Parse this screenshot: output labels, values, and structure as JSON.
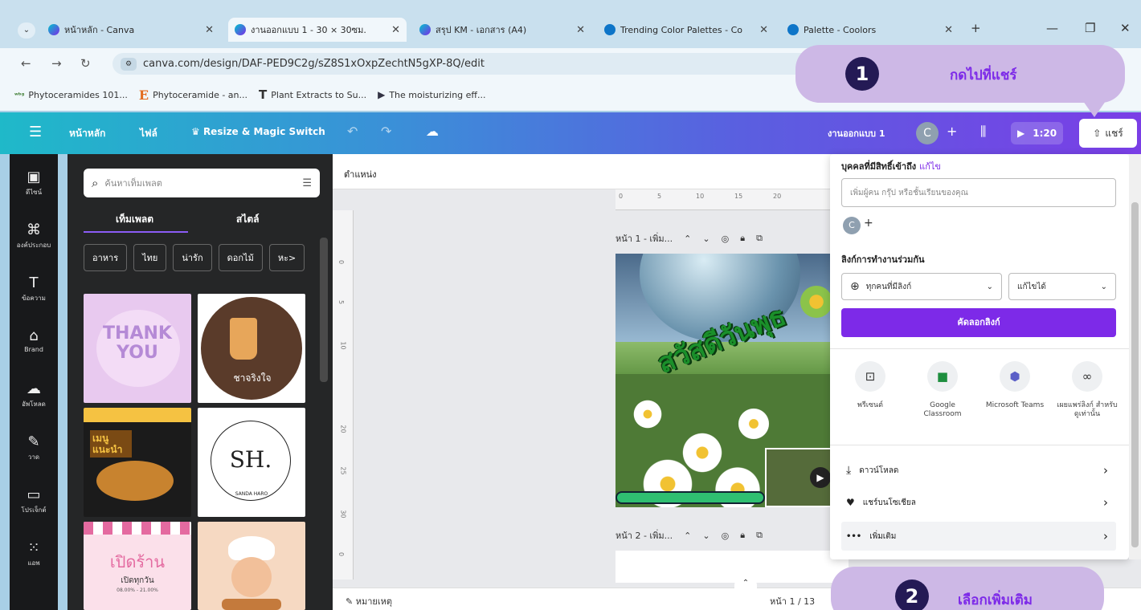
{
  "browser": {
    "tabs": [
      {
        "title": "หน้าหลัก - Canva",
        "favicon": "canva"
      },
      {
        "title": "งานออกแบบ 1 - 30 × 30ซม.",
        "favicon": "canva"
      },
      {
        "title": "สรุป KM - เอกสาร (A4)",
        "favicon": "canva"
      },
      {
        "title": "Trending Color Palettes - Co",
        "favicon": "coolors"
      },
      {
        "title": "Palette - Coolors",
        "favicon": "coolors"
      }
    ],
    "new_tab": "+",
    "url": "canva.com/design/DAF-PED9C2g/sZ8S1xOxpZechtN5gXP-8Q/edit",
    "bookmarks": [
      {
        "icon": "ʷᵇᵍ",
        "label": "Phytoceramides 101..."
      },
      {
        "icon": "E",
        "label": "Phytoceramide - an..."
      },
      {
        "icon": "T",
        "label": "Plant Extracts to Su..."
      },
      {
        "icon": "▶",
        "label": "The moisturizing eff..."
      }
    ]
  },
  "canva_bar": {
    "home": "หน้าหลัก",
    "file": "ไฟล์",
    "resize": "Resize & Magic Switch",
    "design_name": "งานออกแบบ 1",
    "avatar": "C",
    "present_time": "1:20",
    "share_label": "แชร์"
  },
  "rail": [
    {
      "icon": "layout-icon",
      "glyph": "▣",
      "label": "ดีไซน์"
    },
    {
      "icon": "elements-icon",
      "glyph": "⌘",
      "label": "องค์ประกอบ"
    },
    {
      "icon": "text-icon",
      "glyph": "T",
      "label": "ข้อความ"
    },
    {
      "icon": "brand-icon",
      "glyph": "⌂",
      "label": "Brand"
    },
    {
      "icon": "upload-icon",
      "glyph": "☁",
      "label": "อัพโหลด"
    },
    {
      "icon": "draw-icon",
      "glyph": "✎",
      "label": "วาด"
    },
    {
      "icon": "folder-icon",
      "glyph": "▭",
      "label": "โปรเจ็กต์"
    },
    {
      "icon": "apps-icon",
      "glyph": "⁙",
      "label": "แอพ"
    }
  ],
  "panel": {
    "search_placeholder": "ค้นหาเท็มเพลต",
    "tab_templates": "เท็มเพลต",
    "tab_styles": "สไตล์",
    "chips": [
      "อาหาร",
      "ไทย",
      "น่ารัก",
      "ดอกไม้",
      "หะ>"
    ],
    "thumbs": [
      {
        "text": "THANK YOU",
        "bg": "#e8c9ef",
        "fg": "#b58ad6"
      },
      {
        "text": "ชาจริงใจ",
        "bg": "#ffffff",
        "fg": "#5a3b2a"
      },
      {
        "text": "เมนู แนะนำ",
        "bg": "#1b1b1b",
        "fg": "#f5c242"
      },
      {
        "text": "SH.",
        "bg": "#ffffff",
        "fg": "#222222"
      },
      {
        "text": "เปิดร้าน",
        "bg": "#fbe0ea",
        "fg": "#e46aa0"
      },
      {
        "text": "",
        "bg": "#f6d9c2",
        "fg": "#c47a3c"
      }
    ],
    "thumb_sub": {
      "sh_brand": "SANDA HARO",
      "shop_sub": "เปิดทุกวัน",
      "shop_time": "08.00% - 21.00%"
    }
  },
  "canvas": {
    "position_label": "ตำแหน่ง",
    "ruler_top": [
      "0",
      "5",
      "10",
      "15",
      "20"
    ],
    "ruler_left": [
      "0",
      "5",
      "10",
      "20",
      "25",
      "30",
      "0"
    ],
    "page1": "หน้า 1 - เพิ่ม...",
    "page2": "หน้า 2 - เพิ่ม...",
    "design_text": "สวัสดีวันพุธ",
    "notes": "หมายเหตุ",
    "page_counter": "หน้า 1 / 13"
  },
  "share_panel": {
    "access_title": "บุคคลที่มีสิทธิ์เข้าถึง",
    "edit_link": "แก้ไข",
    "invite_placeholder": "เพิ่มผู้คน กรุ๊ป หรือชั้นเรียนของคุณ",
    "avatar": "C",
    "collab_title": "ลิงก์การทำงานร่วมกัน",
    "link_access": "ทุกคนที่มีลิงก์",
    "permission": "แก้ไขได้",
    "copy_link": "คัดลอกลิงก์",
    "share_options": [
      {
        "icon": "present-icon",
        "glyph": "⊡",
        "label": "พรีเซนต์",
        "color": "#333333"
      },
      {
        "icon": "google-classroom-icon",
        "glyph": "■",
        "label": "Google Classroom",
        "color": "#1e8e3e"
      },
      {
        "icon": "microsoft-teams-icon",
        "glyph": "⬢",
        "label": "Microsoft Teams",
        "color": "#5b5fc7"
      },
      {
        "icon": "view-link-icon",
        "glyph": "∞",
        "label": "เผยแพร่ลิงก์ สำหรับดูเท่านั้น",
        "color": "#333333"
      }
    ],
    "rows": [
      {
        "icon": "download-icon",
        "glyph": "⤓",
        "label": "ดาวน์โหลด"
      },
      {
        "icon": "social-share-icon",
        "glyph": "♥",
        "label": "แชร์บนโซเชียล"
      },
      {
        "icon": "more-icon",
        "glyph": "•••",
        "label": "เพิ่มเติม"
      }
    ]
  },
  "callouts": [
    {
      "num": "1",
      "text": "กดไปที่แชร์"
    },
    {
      "num": "2",
      "text": "เลือกเพิ่มเติม"
    }
  ],
  "colors": {
    "accent_purple": "#7d2ae8",
    "callout_bg": "#cdb8e6",
    "callout_num_bg": "#241a55"
  }
}
